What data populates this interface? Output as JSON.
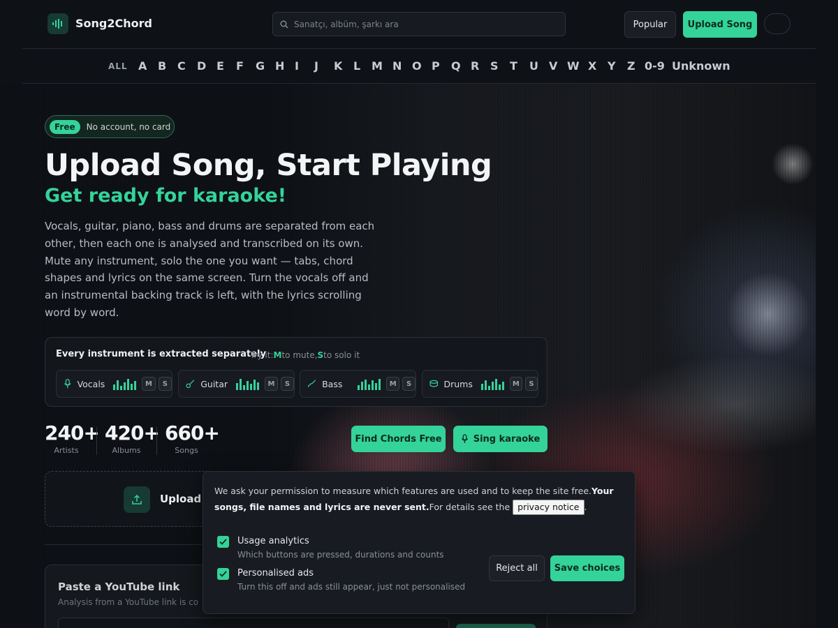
{
  "app": {
    "name": "Song2Chord",
    "accent": "#34d399"
  },
  "header": {
    "search_placeholder": "Sanatçı, albüm, şarkı ara",
    "popular_label": "Popular",
    "upload_label": "Upload Song"
  },
  "alphabet": [
    "ALL",
    "A",
    "B",
    "C",
    "D",
    "E",
    "F",
    "G",
    "H",
    "I",
    "J",
    "K",
    "L",
    "M",
    "N",
    "O",
    "P",
    "Q",
    "R",
    "S",
    "T",
    "U",
    "V",
    "W",
    "X",
    "Y",
    "Z",
    "0-9",
    "Unknown"
  ],
  "hero": {
    "badge_free": "Free",
    "badge_note": "No account, no card",
    "title": "Upload Song, Start Playing",
    "subtitle": "Get ready for karaoke!",
    "lead": "Vocals, guitar, piano, bass and drums are separated from each other, then each one is analysed and transcribed on its own. Mute any instrument, solo the one you want — tabs, chord shapes and lyrics on the same screen. Turn the vocals off and an instrumental backing track is left, with the lyrics scrolling word by word."
  },
  "instruments": {
    "title": "Every instrument is extracted separately",
    "hint_prefix": "Try it:",
    "hint_m": "M",
    "hint_mid": "to mute,",
    "hint_s": "S",
    "hint_suffix": "to solo it",
    "mute_label": "M",
    "solo_label": "S",
    "items": [
      {
        "name": "Vocals",
        "icon": "microphone-icon"
      },
      {
        "name": "Guitar",
        "icon": "guitar-icon"
      },
      {
        "name": "Bass",
        "icon": "bass-icon"
      },
      {
        "name": "Drums",
        "icon": "drum-icon"
      }
    ]
  },
  "stats": [
    {
      "value": "240+",
      "label": "Artists"
    },
    {
      "value": "420+",
      "label": "Albums"
    },
    {
      "value": "660+",
      "label": "Songs"
    }
  ],
  "cta": {
    "find_chords": "Find Chords Free",
    "sing_karaoke": "Sing karaoke"
  },
  "upload_area": {
    "label": "Upload a"
  },
  "youtube": {
    "title": "Paste a YouTube link",
    "subtitle": "Analysis from a YouTube link is co"
  },
  "consent": {
    "text_1": "We ask your permission to measure which features are used and to keep the site free.",
    "text_bold": "Your songs, file names and lyrics are never sent.",
    "text_2": "For details see the",
    "link": "privacy notice",
    "text_end": ".",
    "options": [
      {
        "label": "Usage analytics",
        "desc": "Which buttons are pressed, durations and counts",
        "checked": true
      },
      {
        "label": "Personalised ads",
        "desc": "Turn this off and ads still appear, just not personalised",
        "checked": true
      }
    ],
    "reject_label": "Reject all",
    "save_label": "Save choices"
  }
}
